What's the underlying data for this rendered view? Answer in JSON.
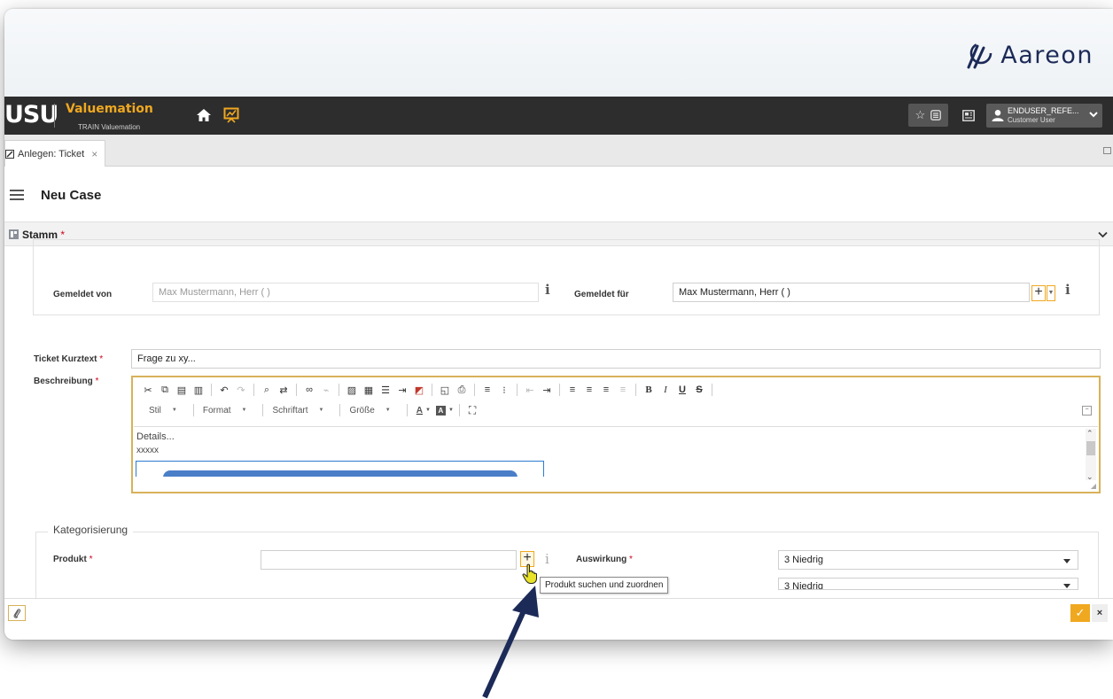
{
  "brand": {
    "name": "Aareon"
  },
  "topbar": {
    "logo": "USU",
    "app_name": "Valuemation",
    "app_subtitle": "TRAIN Valuemation",
    "user_name": "ENDUSER_REFE...",
    "user_role": "Customer User"
  },
  "tabs": [
    {
      "label": "Anlegen: Ticket",
      "close": "×"
    }
  ],
  "case": {
    "title": "Neu Case"
  },
  "section": {
    "title": "Stamm",
    "required_mark": "*"
  },
  "reporter": {
    "gemeldet_von_label": "Gemeldet von",
    "gemeldet_von_value": "Max Mustermann, Herr ( )",
    "gemeldet_fuer_label": "Gemeldet für",
    "gemeldet_fuer_value": "Max Mustermann, Herr ( )"
  },
  "ticket": {
    "kurztext_label": "Ticket Kurztext",
    "kurztext_value": "Frage zu xy...",
    "beschreibung_label": "Beschreibung",
    "required_mark": "*"
  },
  "editor": {
    "combos": [
      "Stil",
      "Format",
      "Schriftart",
      "Größe"
    ],
    "content_lines": [
      "Details...",
      "xxxxx"
    ]
  },
  "kategorisierung": {
    "legend": "Kategorisierung",
    "produkt_label": "Produkt",
    "produkt_value": "",
    "auswirkung_label": "Auswirkung",
    "auswirkung_value": "3 Niedrig",
    "second_value": "3 Niedrig"
  },
  "tooltip": {
    "text": "Produkt suchen und zuordnen"
  },
  "info_glyph": "i",
  "colors": {
    "accent": "#f0a820",
    "topbar": "#2d2d2d",
    "arrow": "#1c2a58"
  }
}
